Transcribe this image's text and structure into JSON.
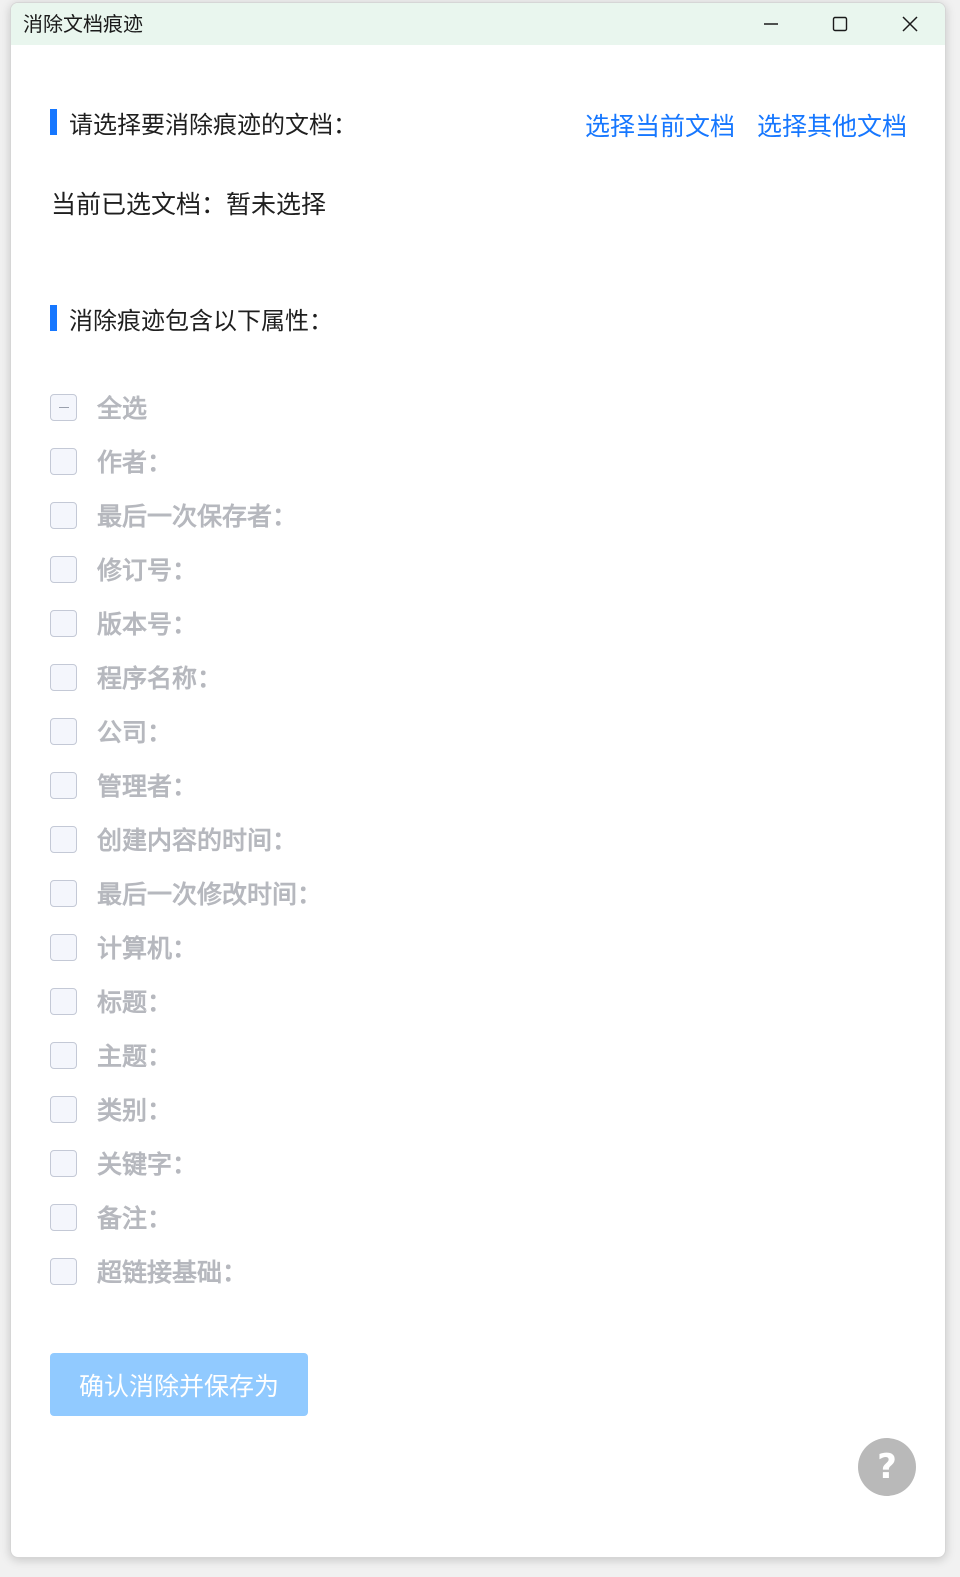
{
  "window": {
    "title": "消除文档痕迹"
  },
  "section_document": {
    "title": "请选择要消除痕迹的文档：",
    "select_current": "选择当前文档",
    "select_other": "选择其他文档",
    "selected_text": "当前已选文档：暂未选择"
  },
  "section_attributes": {
    "title": "消除痕迹包含以下属性：",
    "select_all": "全选",
    "items": [
      "作者：",
      "最后一次保存者：",
      "修订号：",
      "版本号：",
      "程序名称：",
      "公司：",
      "管理者：",
      "创建内容的时间：",
      "最后一次修改时间：",
      "计算机：",
      "标题：",
      "主题：",
      "类别：",
      "关键字：",
      "备注：",
      "超链接基础："
    ]
  },
  "actions": {
    "confirm_label": "确认消除并保存为",
    "help_label": "?"
  },
  "colors": {
    "accent": "#1677ff",
    "disabled_button": "#91caff",
    "titlebar": "#e9f6ee",
    "disabled_text": "#b6b8be"
  },
  "icons": {
    "minimize": "minimize-icon",
    "maximize": "maximize-icon",
    "close": "close-icon"
  }
}
